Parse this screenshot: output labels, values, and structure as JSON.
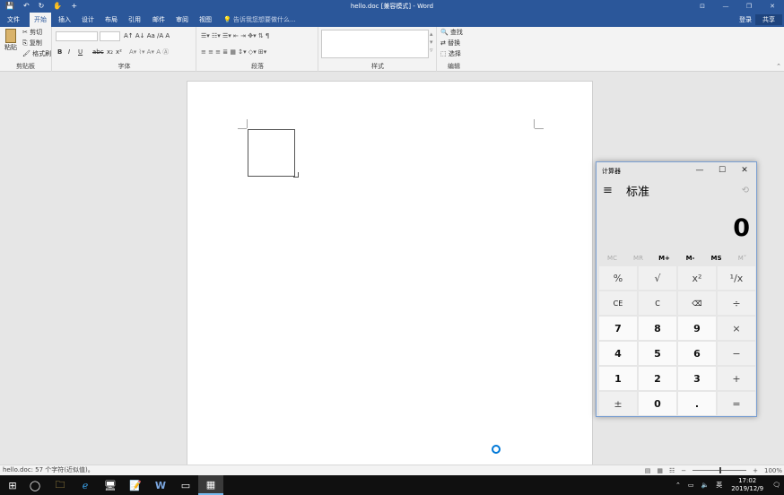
{
  "titlebar": {
    "title": "hello.doc [兼容模式] - Word",
    "qat": [
      "💾",
      "↶",
      "↻",
      "✋",
      "+"
    ],
    "win_controls": [
      "⊡",
      "—",
      "❐",
      "✕"
    ]
  },
  "tabs": [
    "文件",
    "开始",
    "插入",
    "设计",
    "布局",
    "引用",
    "邮件",
    "审阅",
    "视图"
  ],
  "tell_me": "告诉我您想要做什么...",
  "login": "登录",
  "share": "共享",
  "ribbon": {
    "clipboard": {
      "label": "剪贴板",
      "paste": "粘贴",
      "cut": "剪切",
      "copy": "复制",
      "format_painter": "格式刷"
    },
    "font": {
      "label": "字体",
      "bold": "B",
      "italic": "I",
      "underline": "U",
      "strike": "abc",
      "sub": "x₂",
      "sup": "x²"
    },
    "paragraph": {
      "label": "段落"
    },
    "styles": {
      "label": "样式"
    },
    "editing": {
      "label": "编辑",
      "find": "查找",
      "replace": "替换",
      "select": "选择"
    }
  },
  "status": {
    "text": "hello.doc: 57 个字符(近似值)。",
    "zoom": "100%"
  },
  "taskbar": {
    "time": "17:02",
    "date": "2019/12/9",
    "ime": "英"
  },
  "calculator": {
    "title": "计算器",
    "mode": "标准",
    "display": "0",
    "memory": [
      "MC",
      "MR",
      "M+",
      "M-",
      "MS",
      "M˅"
    ],
    "keys": [
      "%",
      "√",
      "x²",
      "¹/x",
      "CE",
      "C",
      "⌫",
      "÷",
      "7",
      "8",
      "9",
      "×",
      "4",
      "5",
      "6",
      "−",
      "1",
      "2",
      "3",
      "+",
      "±",
      "0",
      ".",
      "="
    ]
  }
}
